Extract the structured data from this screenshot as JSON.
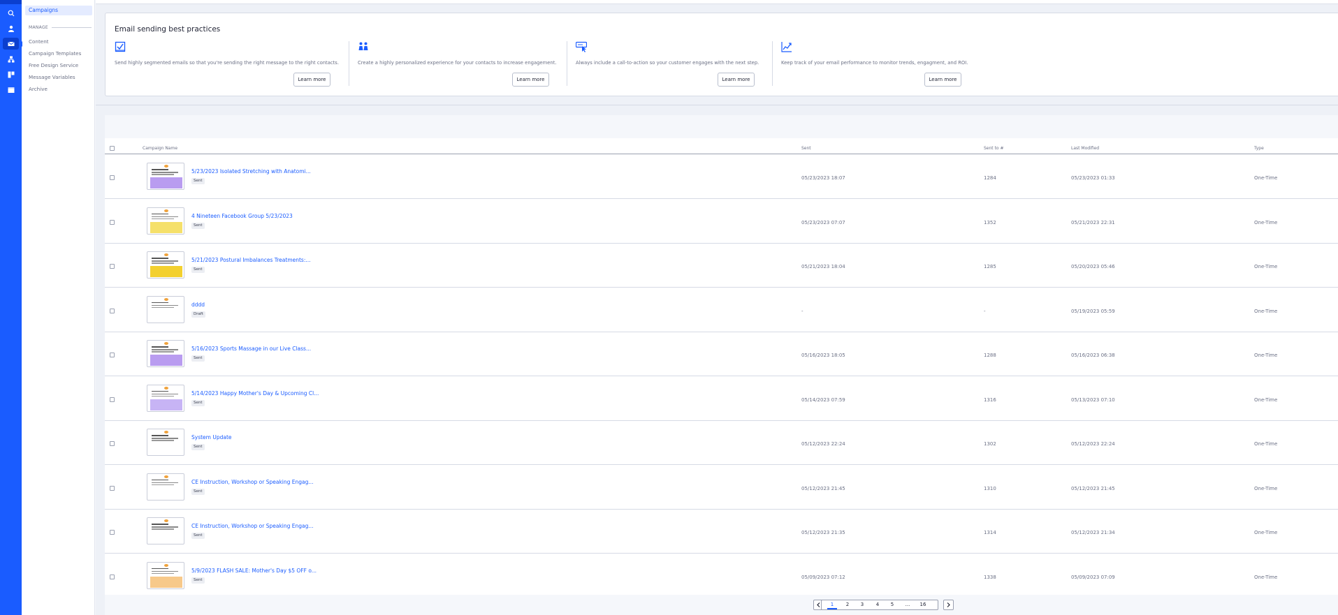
{
  "colors": {
    "accent": "#1a5cff",
    "rail": "#1a5cff",
    "rail_active": "#0b3fcf"
  },
  "rail_icons": [
    "search-icon",
    "user-icon",
    "mail-icon",
    "sitemap-icon",
    "kanban-icon",
    "window-icon"
  ],
  "subnav": {
    "campaigns": "Campaigns",
    "manage_heading": "MANAGE",
    "items": [
      "Content",
      "Campaign Templates",
      "Free Design Service",
      "Message Variables",
      "Archive"
    ]
  },
  "best_practices": {
    "title": "Email sending best practices",
    "tips": [
      {
        "icon": "checklist-icon",
        "text": "Send highly segmented emails so that you're sending the right message to the right contacts.",
        "button": "Learn more"
      },
      {
        "icon": "people-icon",
        "text": "Create a highly personalized experience for your contacts to increase engagement.",
        "button": "Learn more"
      },
      {
        "icon": "cursor-click-icon",
        "text": "Always include a call-to-action so your customer engages with the next step.",
        "button": "Learn more"
      },
      {
        "icon": "chart-line-icon",
        "text": "Keep track of your email performance to monitor trends, engagment, and ROI.",
        "button": "Learn more"
      }
    ]
  },
  "table": {
    "headers": {
      "name": "Campaign Name",
      "sent": "Sent",
      "sent_to": "Sent to #",
      "modified": "Last Modified",
      "type": "Type"
    },
    "rows": [
      {
        "name": "5/23/2023 Isolated Stretching with Anatomi...",
        "status": "Sent",
        "sent": "05/23/2023 18:07",
        "sent_to": "1284",
        "modified": "05/23/2023 01:33",
        "type": "One-Time",
        "thumb_color": "#b99cf0"
      },
      {
        "name": "4 Nineteen Facebook Group 5/23/2023",
        "status": "Sent",
        "sent": "05/23/2023 07:07",
        "sent_to": "1352",
        "modified": "05/21/2023 22:31",
        "type": "One-Time",
        "thumb_color": "#f5e06a"
      },
      {
        "name": "5/21/2023 Postural Imbalances Treatments:...",
        "status": "Sent",
        "sent": "05/21/2023 18:04",
        "sent_to": "1285",
        "modified": "05/20/2023 05:46",
        "type": "One-Time",
        "thumb_color": "#f3d02f"
      },
      {
        "name": "dddd",
        "status": "Draft",
        "sent": "-",
        "sent_to": "-",
        "modified": "05/19/2023 05:59",
        "type": "One-Time",
        "thumb_color": "#ffffff"
      },
      {
        "name": "5/16/2023 Sports Massage in our Live Class...",
        "status": "Sent",
        "sent": "05/16/2023 18:05",
        "sent_to": "1288",
        "modified": "05/16/2023 06:38",
        "type": "One-Time",
        "thumb_color": "#b99cf0"
      },
      {
        "name": "5/14/2023 Happy Mother's Day & Upcoming Cl...",
        "status": "Sent",
        "sent": "05/14/2023 07:59",
        "sent_to": "1316",
        "modified": "05/13/2023 07:10",
        "type": "One-Time",
        "thumb_color": "#c7b4f5"
      },
      {
        "name": "System Update",
        "status": "Sent",
        "sent": "05/12/2023 22:24",
        "sent_to": "1302",
        "modified": "05/12/2023 22:24",
        "type": "One-Time",
        "thumb_color": "#ffffff"
      },
      {
        "name": "CE Instruction, Workshop or Speaking Engag...",
        "status": "Sent",
        "sent": "05/12/2023 21:45",
        "sent_to": "1310",
        "modified": "05/12/2023 21:45",
        "type": "One-Time",
        "thumb_color": "#ffffff"
      },
      {
        "name": "CE Instruction, Workshop or Speaking Engag...",
        "status": "Sent",
        "sent": "05/12/2023 21:35",
        "sent_to": "1314",
        "modified": "05/12/2023 21:34",
        "type": "One-Time",
        "thumb_color": "#ffffff"
      },
      {
        "name": "5/9/2023 FLASH SALE: Mother's Day $5 OFF o...",
        "status": "Sent",
        "sent": "05/09/2023 07:12",
        "sent_to": "1338",
        "modified": "05/09/2023 07:09",
        "type": "One-Time",
        "thumb_color": "#f7c98a"
      }
    ]
  },
  "pagination": {
    "pages": [
      "1",
      "2",
      "3",
      "4",
      "5",
      "...",
      "16"
    ],
    "current": "1"
  }
}
